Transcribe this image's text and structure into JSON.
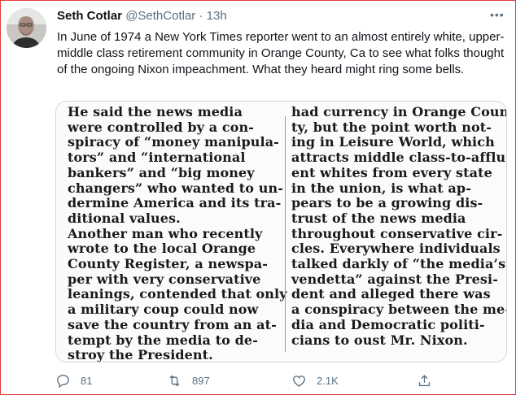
{
  "tweet": {
    "author_name": "Seth Cotlar",
    "handle": "@SethCotlar",
    "separator": "·",
    "time": "13h",
    "more_label": "•••",
    "text": "In June of 1974 a New York Times reporter went to an almost entirely white, upper-middle class retirement community in Orange County, Ca to see what folks thought of the ongoing Nixon impeachment. What they heard might ring some bells."
  },
  "clipping": {
    "left_lines": [
      "He said the news media",
      "were controlled by a con-",
      "spiracy of “money manipula-",
      "tors” and “international",
      "bankers” and “big money",
      "changers” who wanted to un-",
      "dermine America and its tra-",
      "ditional values.",
      "Another man who recently",
      "wrote to the local Orange",
      "County Register, a newspa-",
      "per with very conservative",
      "leanings, contended that only",
      "a military coup could now",
      "save the country from an at-",
      "tempt by the media to de-",
      "stroy the President."
    ],
    "right_lines": [
      "had currency in Orange Coun-",
      "ty, but the point worth not-",
      "ing in Leisure World, which",
      "attracts middle class-to-afflu-",
      "ent whites from every state",
      "in the union, is what ap-",
      "pears to be a growing dis-",
      "trust of the news media",
      "throughout conservative cir-",
      "cles. Everywhere individuals",
      "talked darkly of “the media’s",
      "vendetta” against the Presi-",
      "dent and alleged there was",
      "a conspiracy between the me-",
      "dia and Democratic politi-",
      "cians to oust Mr. Nixon."
    ]
  },
  "actions": {
    "reply_count": "81",
    "retweet_count": "897",
    "like_count": "2.1K",
    "icons": [
      "reply-icon",
      "retweet-icon",
      "like-icon",
      "share-icon"
    ]
  },
  "colors": {
    "text": "#0f1419",
    "muted": "#5b7083",
    "frame": "#e03a3a",
    "border": "#cfd9de"
  }
}
